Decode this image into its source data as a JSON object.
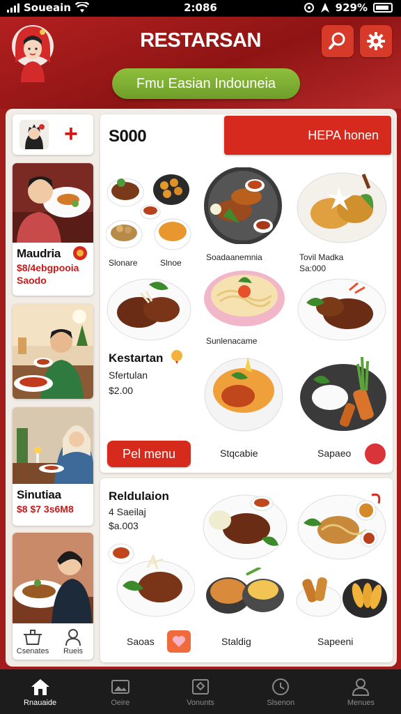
{
  "status": {
    "carrier": "Soueain",
    "time": "2:086",
    "battery": "929%"
  },
  "header": {
    "title": "RESTARSAN",
    "subtitle_pill": "Fmu Easian Indouneia"
  },
  "side": {
    "cards": [
      {
        "name": "Maudria",
        "line1": "$8/4ebgpooia",
        "line2": "Saodo"
      },
      {
        "name": "",
        "line1": "",
        "line2": ""
      },
      {
        "name": "Sinutiaa",
        "line1": "$8 $7 3s6M8",
        "line2": ""
      },
      {
        "name": "",
        "line1": "",
        "line2": ""
      }
    ],
    "bottom_labels": [
      "Csenates",
      "Rueis"
    ]
  },
  "panel1": {
    "price": "S000",
    "cta": "HEPA honen",
    "labels": {
      "small1": "Slonare",
      "small2": "Slnoe",
      "d1": "Soadaanemnia",
      "d2_title": "Tovil Madka",
      "d2_price": "Sa:000",
      "d3": "Sunlenacame",
      "feat_title": "Kestartan",
      "feat_sub": "Sfertulan",
      "feat_price": "$2.00",
      "menu_btn": "Pel menu",
      "d4": "Stqcabie",
      "d5": "Sapaeo"
    }
  },
  "panel2": {
    "title": "Reldulaion",
    "sub": "4 Saeilaj",
    "price": "$a.003",
    "labels": {
      "l1": "Saoas",
      "l2": "Staldig",
      "l3": "Sapeeni"
    }
  },
  "nav": [
    {
      "label": "Rnauaide",
      "icon": "home-icon"
    },
    {
      "label": "Oeire",
      "icon": "gallery-icon"
    },
    {
      "label": "Vonunts",
      "icon": "map-icon"
    },
    {
      "label": "Slsenon",
      "icon": "clock-icon"
    },
    {
      "label": "Menues",
      "icon": "profile-icon"
    }
  ],
  "colors": {
    "header_red": "#a31c1c",
    "accent_red": "#d62a1e",
    "pill_green": "#7fae32",
    "nav_bg": "#1c1c1c"
  }
}
